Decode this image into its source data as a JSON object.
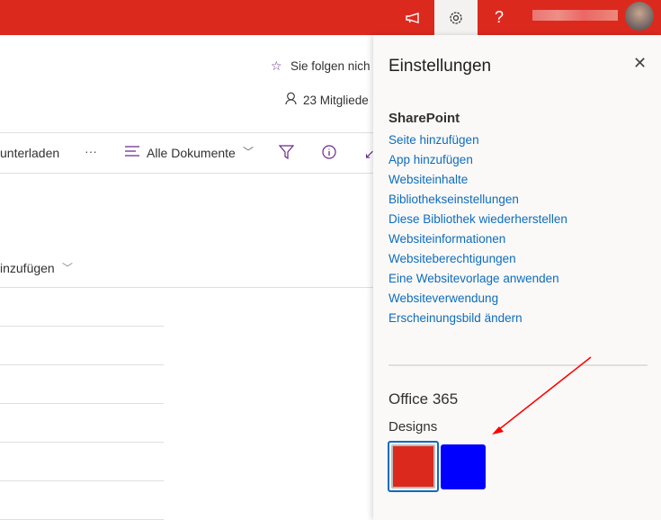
{
  "topbar": {
    "icons": [
      "megaphone-icon",
      "gear-icon",
      "help-icon"
    ],
    "help_label": "?"
  },
  "site": {
    "follow": "Sie folgen nich",
    "members": "23 Mitgliede"
  },
  "commandbar": {
    "download": "unterladen",
    "more": "···",
    "view": "Alle Dokumente"
  },
  "list": {
    "add_column": "inzufügen"
  },
  "panel": {
    "title": "Einstellungen",
    "sharepoint_heading": "SharePoint",
    "links": [
      "Seite hinzufügen",
      "App hinzufügen",
      "Websiteinhalte",
      "Bibliothekseinstellungen",
      "Diese Bibliothek wiederherstellen",
      "Websiteinformationen",
      "Websiteberechtigungen",
      "Eine Websitevorlage anwenden",
      "Websiteverwendung",
      "Erscheinungsbild ändern"
    ],
    "office_heading": "Office 365",
    "designs_heading": "Designs",
    "themes": [
      {
        "color": "#dc291e",
        "selected": true
      },
      {
        "color": "#0000ff",
        "selected": false
      }
    ]
  },
  "accent": "#dc291e"
}
